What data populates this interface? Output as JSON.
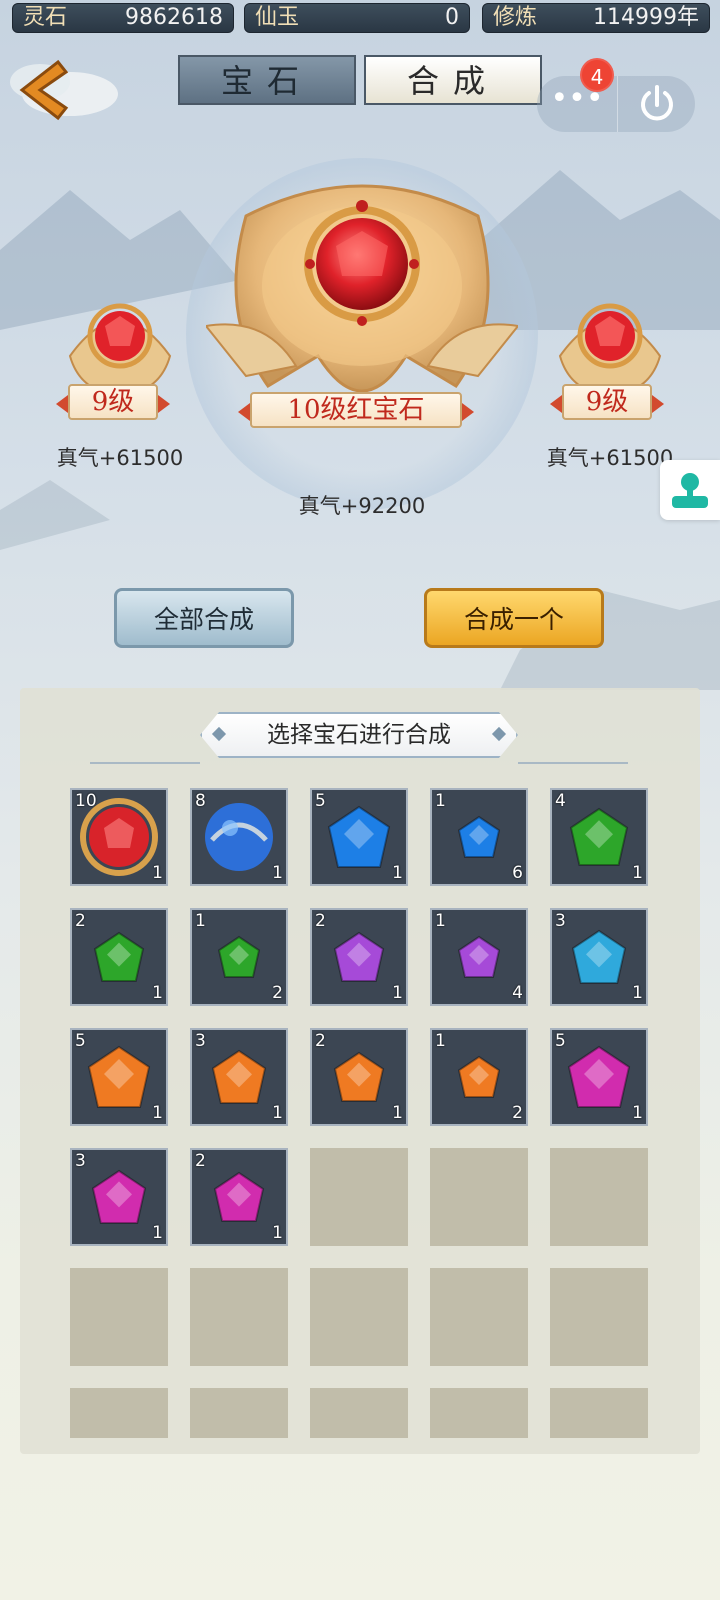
{
  "resources": [
    {
      "label": "灵石",
      "value": "9862618"
    },
    {
      "label": "仙玉",
      "value": "0"
    },
    {
      "label": "修炼",
      "value": "114999年"
    }
  ],
  "tabs": [
    {
      "label": "宝石"
    },
    {
      "label": "合成"
    }
  ],
  "more_button": {
    "label": "•••",
    "badge": "4"
  },
  "synthesis": {
    "left": {
      "level": "9级",
      "stat": "真气+61500"
    },
    "main": {
      "name": "10级红宝石",
      "stat": "真气+92200"
    },
    "right": {
      "level": "9级",
      "stat": "真气+61500"
    }
  },
  "buttons": {
    "synthesize_all": "全部合成",
    "synthesize_one": "合成一个"
  },
  "panel": {
    "title": "选择宝石进行合成",
    "gems": [
      {
        "level": "10",
        "count": "1",
        "color": "red"
      },
      {
        "level": "8",
        "count": "1",
        "color": "blue-orb"
      },
      {
        "level": "5",
        "count": "1",
        "color": "blue"
      },
      {
        "level": "1",
        "count": "6",
        "color": "blue"
      },
      {
        "level": "4",
        "count": "1",
        "color": "green"
      },
      {
        "level": "2",
        "count": "1",
        "color": "green"
      },
      {
        "level": "1",
        "count": "2",
        "color": "green"
      },
      {
        "level": "2",
        "count": "1",
        "color": "purple"
      },
      {
        "level": "1",
        "count": "4",
        "color": "purple"
      },
      {
        "level": "3",
        "count": "1",
        "color": "cyan"
      },
      {
        "level": "5",
        "count": "1",
        "color": "orange"
      },
      {
        "level": "3",
        "count": "1",
        "color": "orange"
      },
      {
        "level": "2",
        "count": "1",
        "color": "orange"
      },
      {
        "level": "1",
        "count": "2",
        "color": "orange"
      },
      {
        "level": "5",
        "count": "1",
        "color": "magenta"
      },
      {
        "level": "3",
        "count": "1",
        "color": "magenta"
      },
      {
        "level": "2",
        "count": "1",
        "color": "magenta"
      }
    ]
  },
  "colors": {
    "red": "#d8232a",
    "blue": "#1d7fe6",
    "green": "#2da62a",
    "purple": "#a64ad8",
    "cyan": "#2fa9dc",
    "orange": "#ef7a22",
    "magenta": "#d12cae"
  }
}
